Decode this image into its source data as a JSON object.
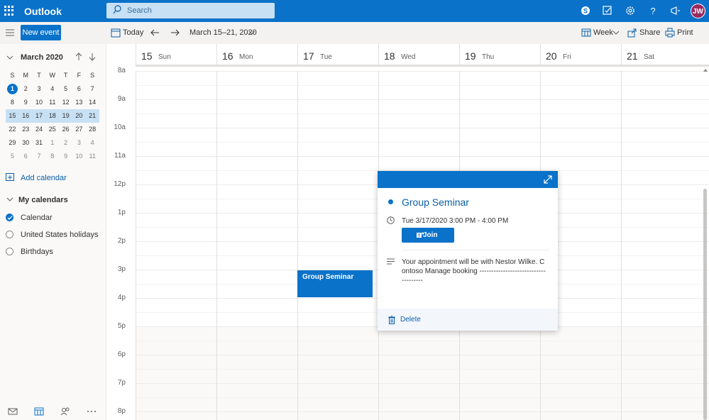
{
  "app": {
    "title": "Outlook"
  },
  "search": {
    "placeholder": "Search"
  },
  "user": {
    "initials": "JW"
  },
  "toolbar": {
    "new_event": "New event",
    "today": "Today",
    "range": "March 15–21, 2020",
    "view": "Week",
    "share": "Share",
    "print": "Print"
  },
  "mini_calendar": {
    "month": "March 2020",
    "dow": [
      "S",
      "M",
      "T",
      "W",
      "T",
      "F",
      "S"
    ],
    "weeks": [
      [
        "1",
        "2",
        "3",
        "4",
        "5",
        "6",
        "7"
      ],
      [
        "8",
        "9",
        "10",
        "11",
        "12",
        "13",
        "14"
      ],
      [
        "15",
        "16",
        "17",
        "18",
        "19",
        "20",
        "21"
      ],
      [
        "22",
        "23",
        "24",
        "25",
        "26",
        "27",
        "28"
      ],
      [
        "29",
        "30",
        "31",
        "1",
        "2",
        "3",
        "4"
      ],
      [
        "5",
        "6",
        "7",
        "8",
        "9",
        "10",
        "11"
      ]
    ],
    "today": "1",
    "selected_week_index": 2
  },
  "sidebar": {
    "add_calendar": "Add calendar",
    "my_calendars": "My calendars",
    "calendars": [
      {
        "label": "Calendar",
        "checked": true
      },
      {
        "label": "United States holidays",
        "checked": false
      },
      {
        "label": "Birthdays",
        "checked": false
      }
    ]
  },
  "week": {
    "days": [
      {
        "num": "15",
        "name": "Sun"
      },
      {
        "num": "16",
        "name": "Mon"
      },
      {
        "num": "17",
        "name": "Tue"
      },
      {
        "num": "18",
        "name": "Wed"
      },
      {
        "num": "19",
        "name": "Thu"
      },
      {
        "num": "20",
        "name": "Fri"
      },
      {
        "num": "21",
        "name": "Sat"
      }
    ],
    "hours": [
      "8a",
      "9a",
      "10a",
      "11a",
      "12p",
      "1p",
      "2p",
      "3p",
      "4p",
      "5p",
      "6p",
      "7p",
      "8p"
    ]
  },
  "event": {
    "title": "Group Seminar"
  },
  "popup": {
    "title": "Group Seminar",
    "time": "Tue 3/17/2020 3:00 PM - 4:00 PM",
    "join": "Join",
    "notes": "Your appointment will be with Nestor Wilke. Contoso Manage booking -------------------------------------",
    "delete": "Delete"
  },
  "colors": {
    "brand": "#0a72c9",
    "selected_week": "#c7e0f4",
    "avatar": "#9b2a61"
  }
}
